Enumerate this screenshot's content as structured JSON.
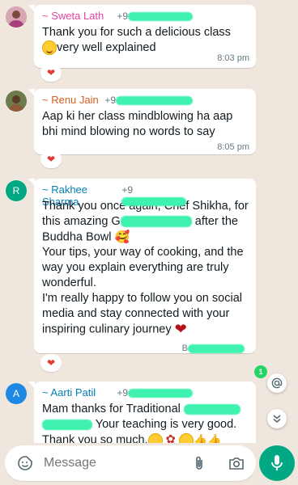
{
  "messages": [
    {
      "sender": "~ Sweta Lath",
      "sender_color": "#e542a3",
      "phone_prefix": "+9",
      "lines": [
        "Thank you for such a delicious class",
        "very well explained"
      ],
      "time": "8:03 pm",
      "reaction": "heart"
    },
    {
      "sender": "~ Renu Jain",
      "sender_color": "#d3621d",
      "phone_prefix": "+9",
      "lines": [
        "Aap ki her class mindblowing ha aap",
        "bhi mind blowing no words to say"
      ],
      "time": "8:05 pm",
      "reaction": "heart"
    },
    {
      "sender": "~ Rakhee Sharma",
      "sender_color": "#027eb5",
      "avatar_letter": "R",
      "avatar_color": "#00a884",
      "phone_prefix": "+9",
      "lines": [
        "Thank you once again, Chef Shikha, for",
        "this amazing G",
        "after the",
        "Buddha Bowl",
        "Your tips, your way of cooking, and the",
        "way you explain everything are truly",
        "wonderful.",
        "I'm really happy to follow you on social",
        "media and stay connected with your",
        "inspiring culinary journey"
      ],
      "time_prefix": "B",
      "reaction": "heart"
    },
    {
      "sender": "~ Aarti Patil",
      "sender_color": "#027eb5",
      "avatar_letter": "A",
      "avatar_color": "#1e88e5",
      "phone_prefix": "+9",
      "lines": [
        "Mam thanks for Traditional",
        "Your teaching is very good.",
        "Thank you so much."
      ]
    }
  ],
  "floating": {
    "unread_count": "1",
    "mention_icon": "at-icon",
    "scroll_icon": "double-chevron-down-icon"
  },
  "composer": {
    "placeholder": "Message",
    "emoji_icon": "sticker-icon",
    "attach_icon": "paperclip-icon",
    "camera_icon": "camera-icon",
    "send_icon": "mic-icon"
  },
  "colors": {
    "background": "#efe7dd",
    "accent": "#00a884",
    "redaction": "#3ff2b0"
  }
}
